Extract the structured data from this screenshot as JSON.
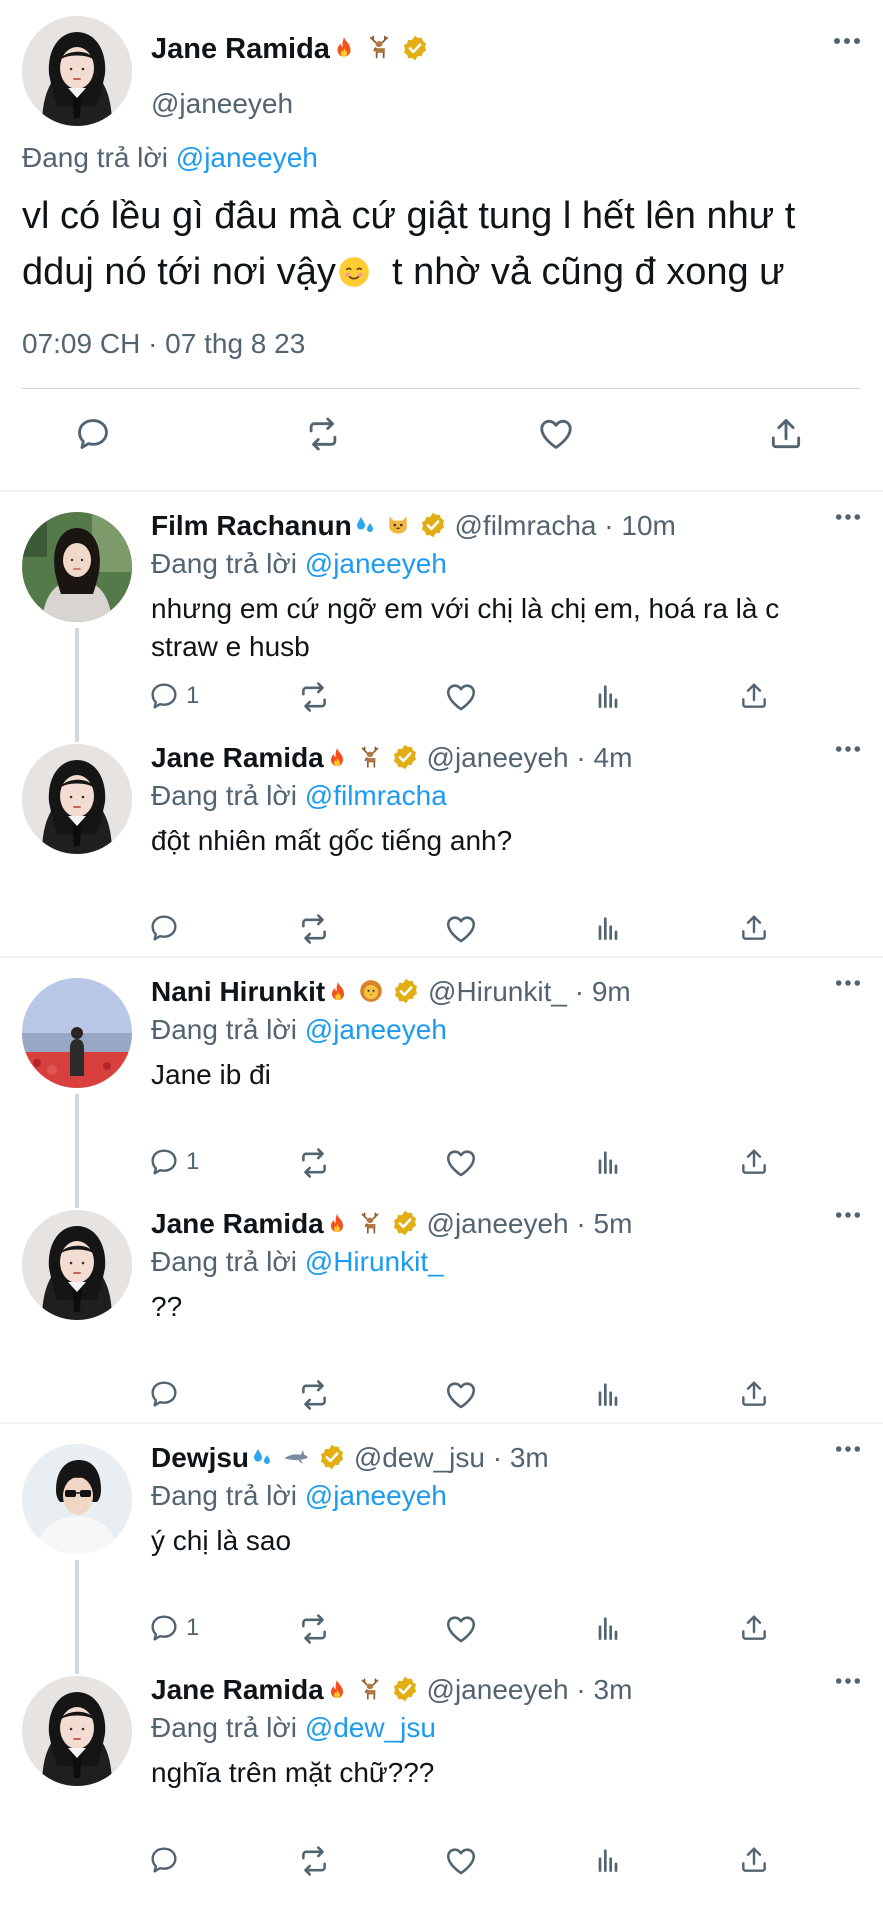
{
  "main": {
    "name": "Jane Ramida",
    "handle": "@janeeyeh",
    "replying_prefix": "Đang trả lời",
    "replying_to": "@janeeyeh",
    "text_line1": "vl có lều gì đâu mà cứ giật tung l hết lên như t",
    "text_line2a": "dduj nó tới nơi vậy",
    "text_line2b": "  t nhờ vả cũng đ xong ư",
    "timestamp": "07:09 CH · 07 thg 8 23"
  },
  "replies": [
    {
      "name": "Film Rachanun",
      "handle": "@filmracha",
      "dot": " · ",
      "time": "10m",
      "replying_prefix": "Đang trả lời",
      "replying_to": "@janeeyeh",
      "text": "nhưng em cứ ngỡ em với chị là chị em, hoá ra là c straw e husb",
      "reply_count": "1"
    },
    {
      "name": "Jane Ramida",
      "handle": "@janeeyeh",
      "dot": " · ",
      "time": "4m",
      "replying_prefix": "Đang trả lời",
      "replying_to": "@filmracha",
      "text": "đột nhiên mất gốc tiếng anh?",
      "reply_count": ""
    },
    {
      "name": "Nani Hirunkit",
      "handle": "@Hirunkit_",
      "dot": " · ",
      "time": "9m",
      "replying_prefix": "Đang trả lời",
      "replying_to": "@janeeyeh",
      "text": "Jane ib đi",
      "reply_count": "1"
    },
    {
      "name": "Jane Ramida",
      "handle": "@janeeyeh",
      "dot": " · ",
      "time": "5m",
      "replying_prefix": "Đang trả lời",
      "replying_to": "@Hirunkit_",
      "text": "??",
      "reply_count": ""
    },
    {
      "name": "Dewjsu",
      "handle": "@dew_jsu",
      "dot": " · ",
      "time": "3m",
      "replying_prefix": "Đang trả lời",
      "replying_to": "@janeeyeh",
      "text": "ý chị là sao",
      "reply_count": "1"
    },
    {
      "name": "Jane Ramida",
      "handle": "@janeeyeh",
      "dot": " · ",
      "time": "3m",
      "replying_prefix": "Đang trả lời",
      "replying_to": "@dew_jsu",
      "text": "nghĩa trên mặt chữ???",
      "reply_count": ""
    }
  ],
  "colors": {
    "accent": "#1d9bf0",
    "secondary_text": "#536471",
    "verified_badge": "#e3ae14",
    "divider": "#eff3f4"
  },
  "icons": {
    "reply": "speech-bubble-icon",
    "retweet": "retweet-icon",
    "like": "heart-icon",
    "views": "bar-chart-icon",
    "share": "share-icon",
    "more": "ellipsis-icon",
    "verified": "verified-badge-icon"
  }
}
